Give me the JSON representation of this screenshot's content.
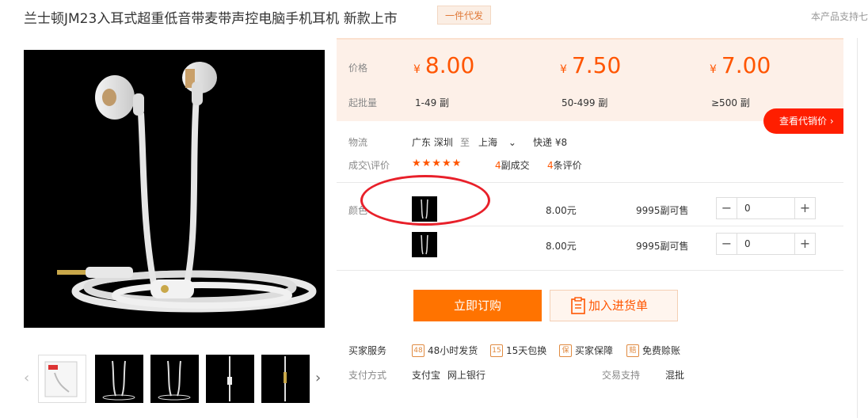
{
  "header": {
    "title": "兰士顿JM23入耳式超重低音带麦带声控电脑手机耳机 新款上市",
    "tag": "一件代发",
    "right_note": "本产品支持七"
  },
  "price_panel": {
    "price_label": "价格",
    "qty_label": "起批量",
    "tiers": [
      {
        "currency": "¥",
        "price": "8.00",
        "qty": "1-49 副"
      },
      {
        "currency": "¥",
        "price": "7.50",
        "qty": "50-499 副"
      },
      {
        "currency": "¥",
        "price": "7.00",
        "qty": "≥500 副"
      }
    ],
    "dx_button": "查看代销价",
    "dx_chevron": "›"
  },
  "logistics": {
    "label": "物流",
    "from": "广东 深圳",
    "to_word": "至",
    "to": "上海",
    "dropdown_icon": "⌄",
    "express": "快递 ¥8"
  },
  "deals": {
    "label": "成交\\评价",
    "stars": "★★★★★",
    "sold_count": "4",
    "sold_text": "副成交",
    "review_count": "4",
    "review_text": "条评价"
  },
  "sku": {
    "label": "颜色",
    "rows": [
      {
        "price": "8.00元",
        "stock": "9995副可售",
        "qty": "0"
      },
      {
        "price": "8.00元",
        "stock": "9995副可售",
        "qty": "0"
      }
    ],
    "minus": "−",
    "plus": "+"
  },
  "actions": {
    "order": "立即订购",
    "cart": "加入进货单"
  },
  "services": {
    "label": "买家服务",
    "items": [
      {
        "icon": "48",
        "text": "48小时发货"
      },
      {
        "icon": "15",
        "text": "15天包换"
      },
      {
        "icon": "保",
        "text": "买家保障"
      },
      {
        "icon": "赔",
        "text": "免费赊账"
      }
    ]
  },
  "payment": {
    "label": "支付方式",
    "methods": [
      "支付宝",
      "网上银行"
    ],
    "trade_label": "交易支持",
    "trade_value": "混批"
  },
  "gallery": {
    "prev": "‹",
    "next": "›"
  },
  "colors": {
    "accent": "#ff5500",
    "order_button": "#ff7300",
    "dx_button": "#ff1e00",
    "annotation": "#e8202a"
  }
}
